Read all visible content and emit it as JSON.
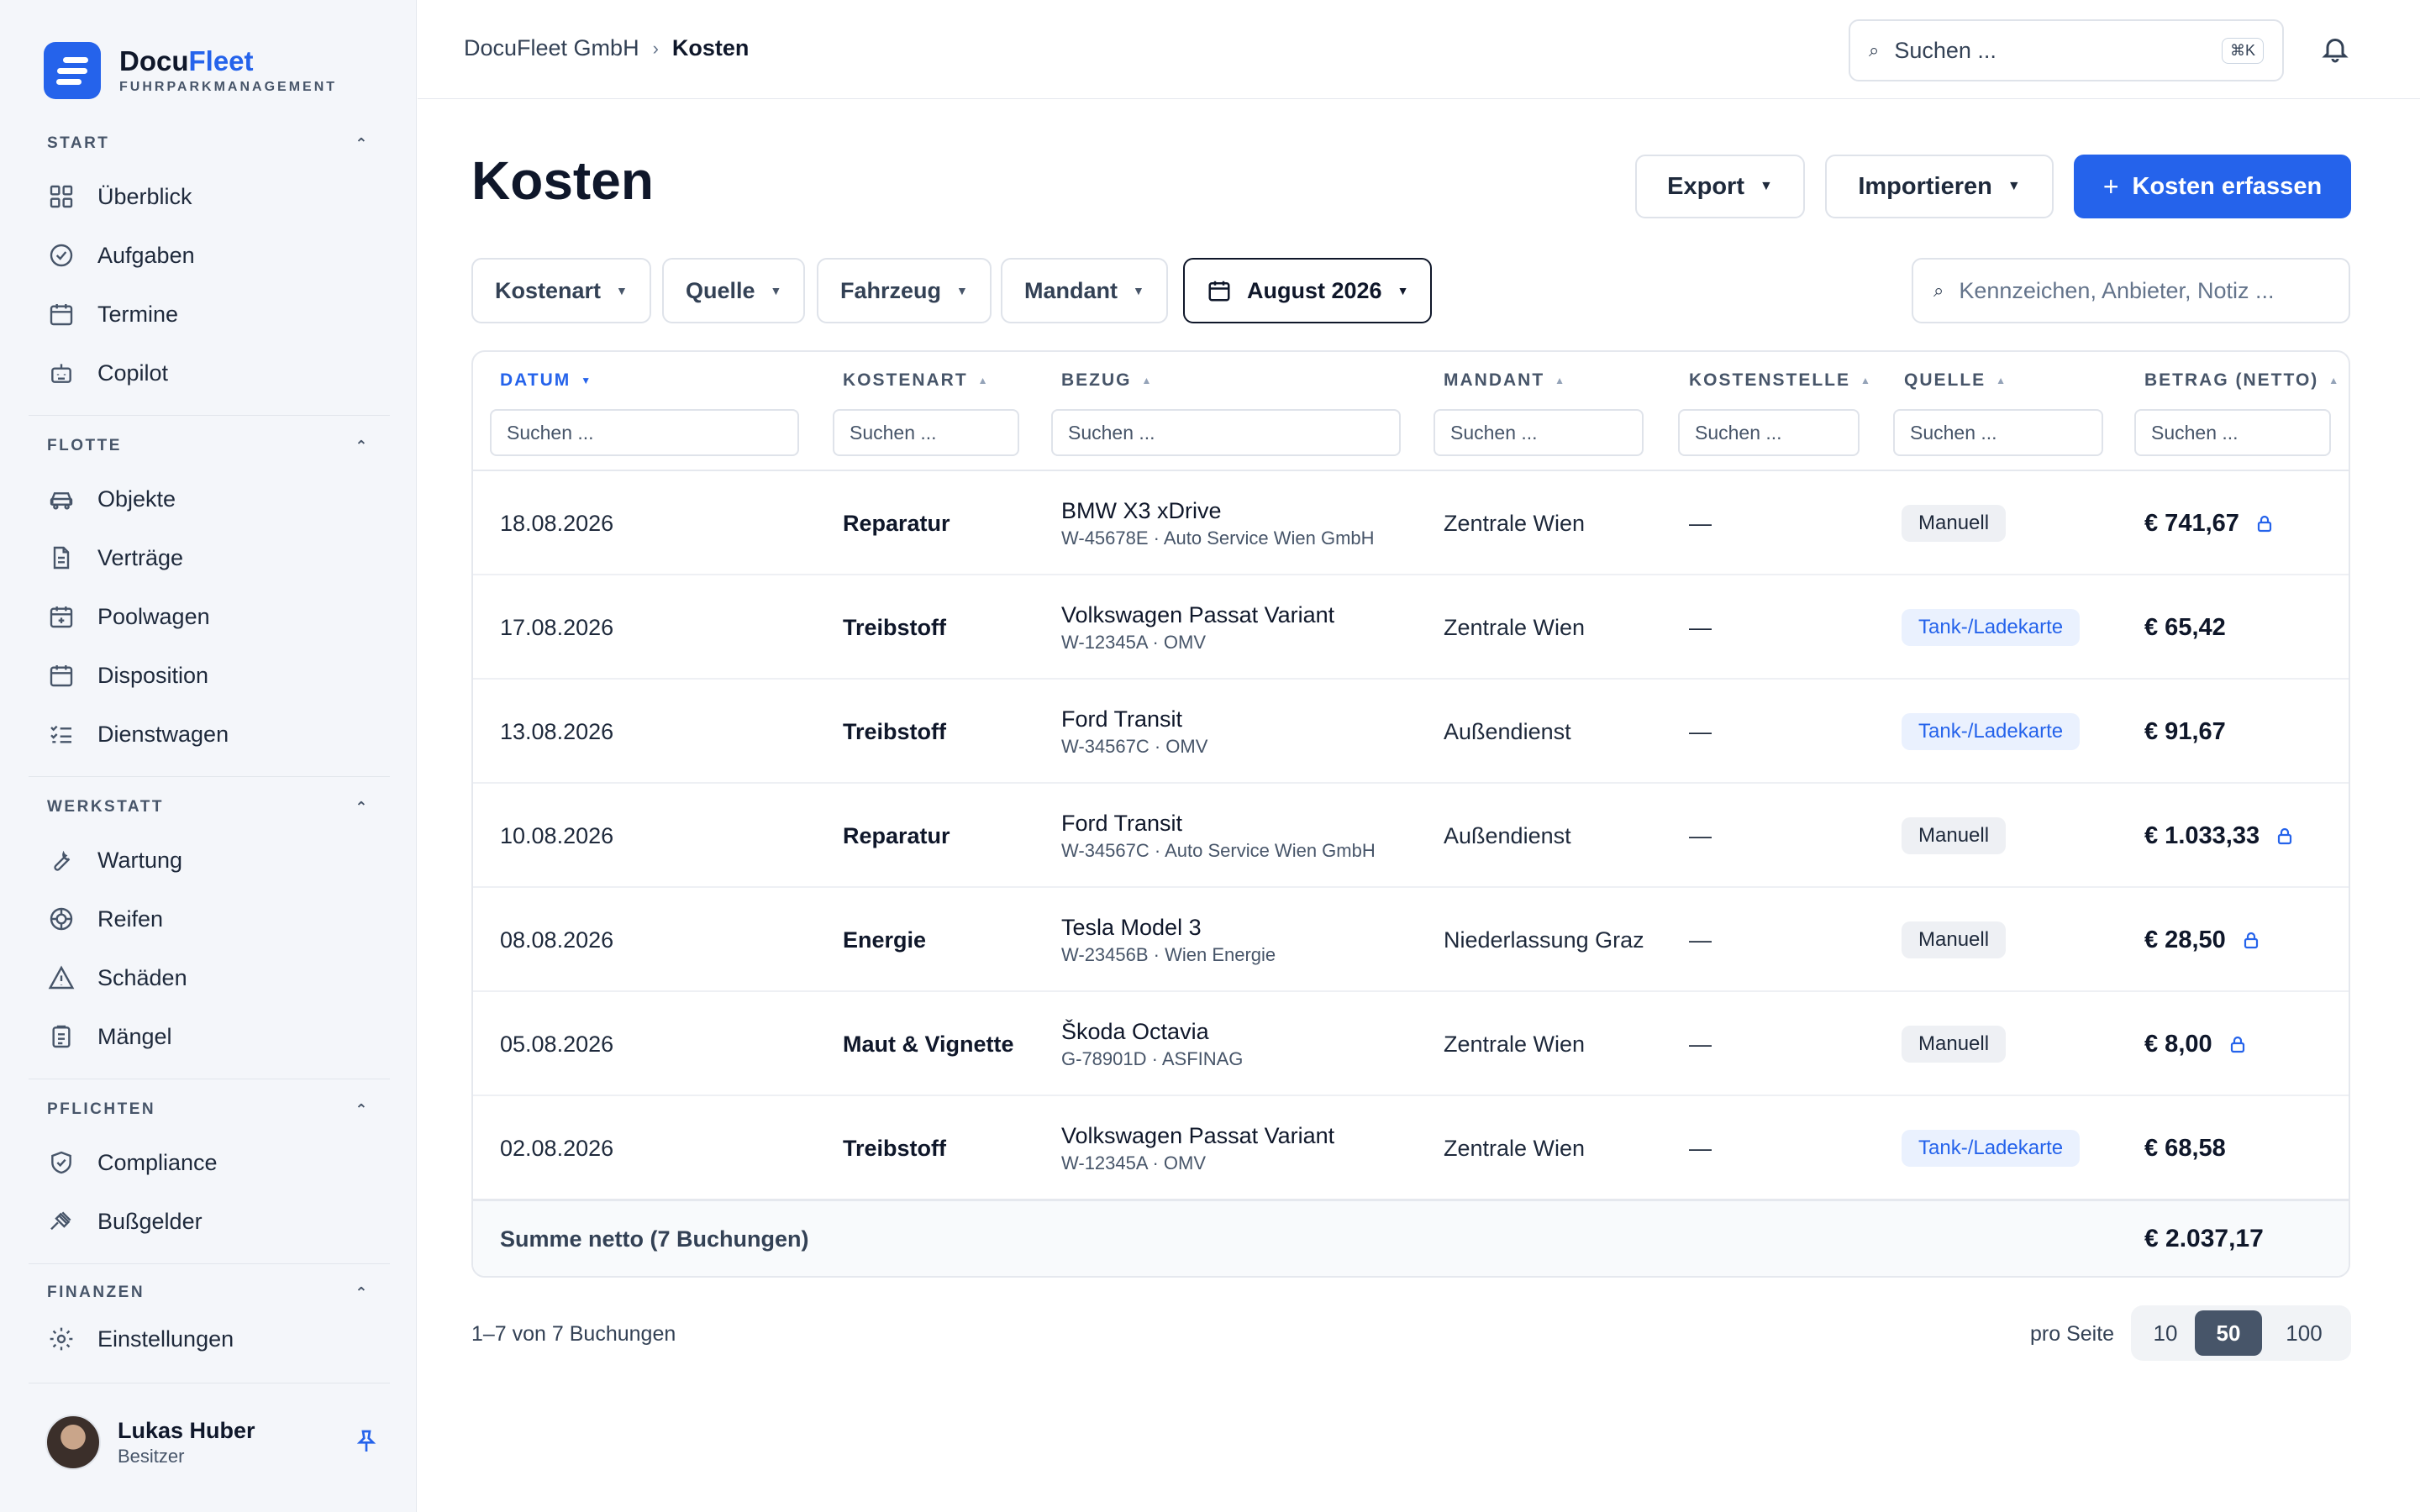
{
  "brand": {
    "name_part1": "Docu",
    "name_part2": "Fleet",
    "subtitle": "FUHRPARKMANAGEMENT"
  },
  "sidebar": {
    "groups": [
      {
        "label": "START",
        "items": [
          {
            "label": "Überblick",
            "icon": "grid-icon"
          },
          {
            "label": "Aufgaben",
            "icon": "check-circle-icon"
          },
          {
            "label": "Termine",
            "icon": "calendar-icon"
          },
          {
            "label": "Copilot",
            "icon": "bot-icon"
          }
        ]
      },
      {
        "label": "FLOTTE",
        "items": [
          {
            "label": "Objekte",
            "icon": "car-icon"
          },
          {
            "label": "Verträge",
            "icon": "document-icon"
          },
          {
            "label": "Poolwagen",
            "icon": "calendar-plus-icon"
          },
          {
            "label": "Disposition",
            "icon": "calendar-icon"
          },
          {
            "label": "Dienstwagen",
            "icon": "list-check-icon"
          }
        ]
      },
      {
        "label": "WERKSTATT",
        "items": [
          {
            "label": "Wartung",
            "icon": "wrench-icon"
          },
          {
            "label": "Reifen",
            "icon": "tire-icon"
          },
          {
            "label": "Schäden",
            "icon": "warning-icon"
          },
          {
            "label": "Mängel",
            "icon": "clipboard-icon"
          }
        ]
      },
      {
        "label": "PFLICHTEN",
        "items": [
          {
            "label": "Compliance",
            "icon": "shield-check-icon"
          },
          {
            "label": "Bußgelder",
            "icon": "gavel-icon"
          }
        ]
      },
      {
        "label": "FINANZEN",
        "items": []
      }
    ],
    "settings_label": "Einstellungen",
    "user": {
      "name": "Lukas Huber",
      "role": "Besitzer"
    }
  },
  "header": {
    "breadcrumb": [
      "DocuFleet GmbH",
      "Kosten"
    ],
    "search_placeholder": "Suchen ...",
    "search_shortcut": "⌘K"
  },
  "page": {
    "title": "Kosten",
    "export_label": "Export",
    "import_label": "Importieren",
    "add_label": "Kosten erfassen"
  },
  "filters": {
    "items": [
      "Kostenart",
      "Quelle",
      "Fahrzeug",
      "Mandant"
    ],
    "date": "August 2026",
    "search_placeholder": "Kennzeichen, Anbieter, Notiz ..."
  },
  "table": {
    "columns": [
      "DATUM",
      "KOSTENART",
      "BEZUG",
      "MANDANT",
      "KOSTENSTELLE",
      "QUELLE",
      "BETRAG (NETTO)"
    ],
    "column_search_placeholder": "Suchen ...",
    "rows": [
      {
        "date": "18.08.2026",
        "type": "Reparatur",
        "vehicle": "BMW X3 xDrive",
        "detail": "W-45678E · Auto Service Wien GmbH",
        "client": "Zentrale Wien",
        "cost_center": "—",
        "source": "Manuell",
        "amount": "€ 741,67",
        "locked": true
      },
      {
        "date": "17.08.2026",
        "type": "Treibstoff",
        "vehicle": "Volkswagen Passat Variant",
        "detail": "W-12345A · OMV",
        "client": "Zentrale Wien",
        "cost_center": "—",
        "source": "Tank-/Ladekarte",
        "amount": "€ 65,42",
        "locked": false
      },
      {
        "date": "13.08.2026",
        "type": "Treibstoff",
        "vehicle": "Ford Transit",
        "detail": "W-34567C · OMV",
        "client": "Außendienst",
        "cost_center": "—",
        "source": "Tank-/Ladekarte",
        "amount": "€ 91,67",
        "locked": false
      },
      {
        "date": "10.08.2026",
        "type": "Reparatur",
        "vehicle": "Ford Transit",
        "detail": "W-34567C · Auto Service Wien GmbH",
        "client": "Außendienst",
        "cost_center": "—",
        "source": "Manuell",
        "amount": "€ 1.033,33",
        "locked": true
      },
      {
        "date": "08.08.2026",
        "type": "Energie",
        "vehicle": "Tesla Model 3",
        "detail": "W-23456B · Wien Energie",
        "client": "Niederlassung Graz",
        "cost_center": "—",
        "source": "Manuell",
        "amount": "€ 28,50",
        "locked": true
      },
      {
        "date": "05.08.2026",
        "type": "Maut & Vignette",
        "vehicle": "Škoda Octavia",
        "detail": "G-78901D · ASFINAG",
        "client": "Zentrale Wien",
        "cost_center": "—",
        "source": "Manuell",
        "amount": "€ 8,00",
        "locked": true
      },
      {
        "date": "02.08.2026",
        "type": "Treibstoff",
        "vehicle": "Volkswagen Passat Variant",
        "detail": "W-12345A · OMV",
        "client": "Zentrale Wien",
        "cost_center": "—",
        "source": "Tank-/Ladekarte",
        "amount": "€ 68,58",
        "locked": false
      }
    ],
    "sum_label": "Summe netto (7 Buchungen)",
    "sum_value": "€ 2.037,17"
  },
  "footer": {
    "count_text": "1–7 von 7 Buchungen",
    "per_page_label": "pro Seite",
    "per_page_options": [
      "10",
      "50",
      "100"
    ],
    "per_page_selected": "50"
  },
  "colors": {
    "accent": "#2563eb",
    "text": "#0f172a",
    "muted": "#475569"
  }
}
